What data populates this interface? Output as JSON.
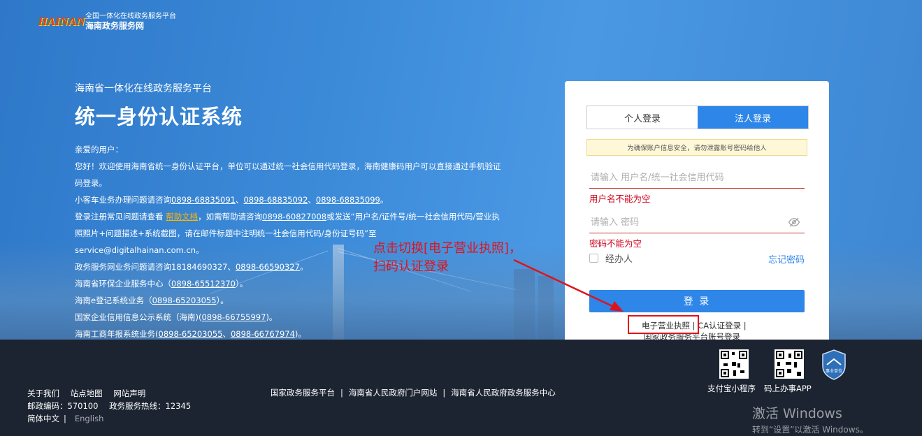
{
  "header": {
    "logo_text": "HAINAN",
    "platform_small": "全国一体化在线政务服务平台",
    "site_name": "海南政务服务网"
  },
  "hero": {
    "platform": "海南省一体化在线政务服务平台",
    "title": "统一身份认证系统",
    "notice": {
      "greeting": "亲爱的用户：",
      "line1": "您好！欢迎使用海南省统一身份认证平台，单位可以通过统一社会信用代码登录，海南健康码用户可以直接通过手机验证码登录。",
      "line2_prefix": "小客车业务办理问题请咨询",
      "line2_phone1": "0898-68835091",
      "line2_phone2": "0898-68835092",
      "line2_phone3": "0898-68835099",
      "line3_prefix": "登录注册常见问题请查看",
      "line3_help": "帮助文档",
      "line3_mid": "，如需帮助请咨询",
      "line3_phone": "0898-60827008",
      "line3_suffix": "或发送“用户名/证件号/统一社会信用代码/营业执照照片+问题描述+系统截图，请在邮件标题中注明统一社会信用代码/身份证号码”至",
      "line4": "service@digitalhainan.com.cn。",
      "line5_prefix": "政务服务网业务问题请咨询18184690327、",
      "line5_phone": "0898-66590327",
      "line6_prefix": "海南省环保企业服务中心（",
      "line6_phone": "0898-65512370",
      "line6_suffix": "）。",
      "line7_prefix": "海南e登记系统业务（",
      "line7_phone": "0898-65203055",
      "line7_suffix": "）。",
      "line8_prefix": "国家企业信用信息公示系统（海南)(",
      "line8_phone": "0898-66755997",
      "line8_suffix": ")。",
      "line9_prefix": "海南工商年报系统业务(",
      "line9_phone1": "0898-65203055",
      "line9_phone2": "0898-66767974",
      "line9_suffix": ")。"
    }
  },
  "login": {
    "tab_personal": "个人登录",
    "tab_legal": "法人登录",
    "tip": "为确保账户信息安全，请勿泄露账号密码给他人",
    "username_placeholder": "请输入 用户名/统一社会信用代码",
    "username_error": "用户名不能为空",
    "password_placeholder": "请输入 密码",
    "password_error": "密码不能为空",
    "agent_label": "经办人",
    "forgot": "忘记密码",
    "submit": "登 录",
    "alt_license": "电子营业执照",
    "alt_sep": "|",
    "alt_ca": "CA认证登录",
    "alt_gov": "国家政务服务平台账号登录"
  },
  "annotation": {
    "line1": "点击切换[电子营业执照]，",
    "line2": "扫码认证登录"
  },
  "footer": {
    "about": "关于我们",
    "sitemap": "站点地图",
    "statement": "网站声明",
    "postcode": "邮政编码：570100",
    "hotline": "政务服务热线：12345",
    "lang_cn": "简体中文",
    "lang_sep": "|",
    "lang_en": "English",
    "link1": "国家政务服务平台",
    "link2": "海南省人民政府门户网站",
    "link3": "海南省人民政府政务服务中心",
    "link_sep": "|",
    "qr1_label": "支付宝小程序",
    "qr2_label": "码上办事APP",
    "badge_text": "事业单位"
  },
  "watermark": {
    "line1": "激活 Windows",
    "line2": "转到“设置”以激活 Windows。"
  }
}
